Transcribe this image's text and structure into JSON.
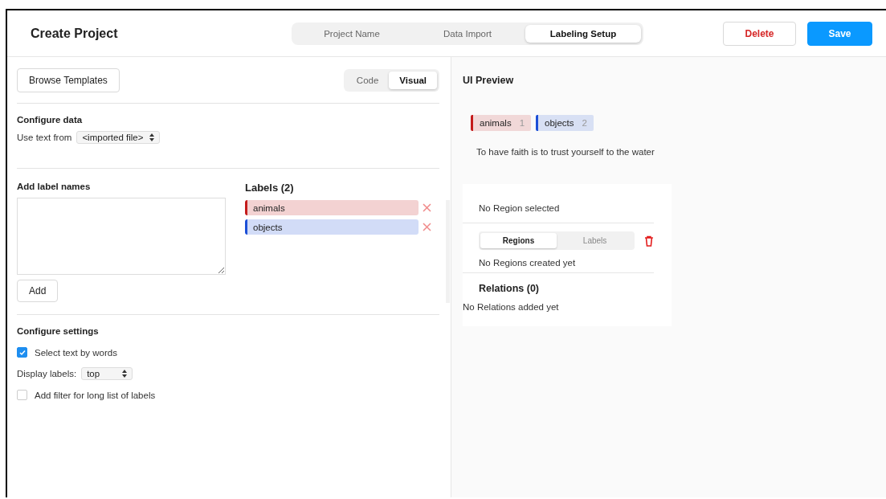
{
  "header": {
    "title": "Create Project",
    "steps": [
      {
        "label": "Project Name",
        "selected": false
      },
      {
        "label": "Data Import",
        "selected": false
      },
      {
        "label": "Labeling Setup",
        "selected": true
      }
    ],
    "delete_button": "Delete",
    "save_button": "Save"
  },
  "toolbar": {
    "browse_button": "Browse Templates",
    "modes": [
      {
        "label": "Code",
        "selected": false
      },
      {
        "label": "Visual",
        "selected": true
      }
    ]
  },
  "configure_data": {
    "title": "Configure data",
    "label": "Use text from",
    "select_value": "<imported file>"
  },
  "add_labels": {
    "title": "Add label names",
    "add_button": "Add"
  },
  "labels": {
    "title": "Labels (2)",
    "items": [
      {
        "name": "animals",
        "color": "#c41c1c"
      },
      {
        "name": "objects",
        "color": "#1c4fd6"
      }
    ]
  },
  "settings": {
    "title": "Configure settings",
    "options": [
      {
        "kind": "checkbox",
        "label": "Select text by words",
        "checked": true
      },
      {
        "kind": "select",
        "label": "Display labels:",
        "value": "top"
      },
      {
        "kind": "checkbox",
        "label": "Add filter for long list of labels",
        "checked": false
      }
    ]
  },
  "preview": {
    "title": "UI Preview",
    "tags": [
      {
        "name": "animals",
        "hotkey": "1",
        "color": "#c41c1c"
      },
      {
        "name": "objects",
        "hotkey": "2",
        "color": "#1c4fd6"
      }
    ],
    "text": "To have faith is to trust yourself to the water",
    "region_status": "No Region selected",
    "tabs": [
      {
        "label": "Regions",
        "selected": true
      },
      {
        "label": "Labels",
        "selected": false
      }
    ],
    "regions_empty": "No Regions created yet",
    "relations_title": "Relations (0)",
    "relations_empty": "No Relations added yet"
  }
}
